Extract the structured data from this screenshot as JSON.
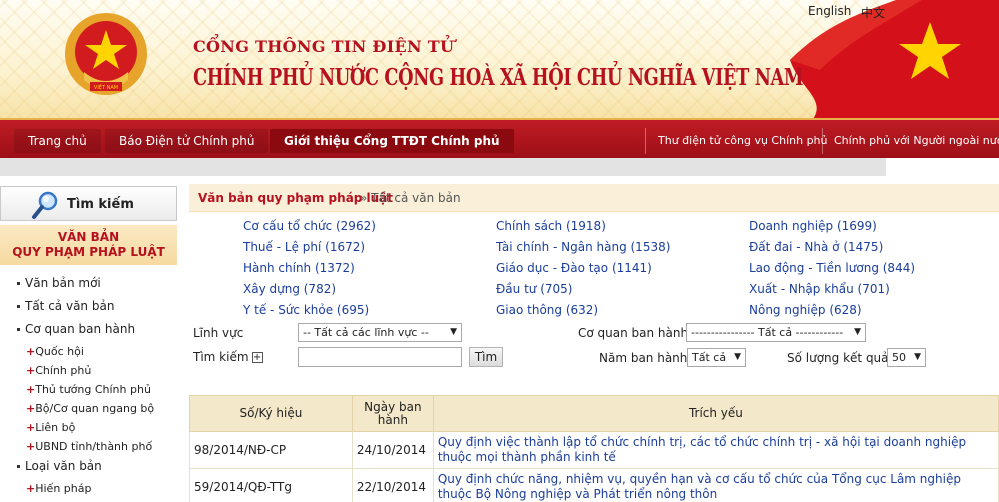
{
  "header": {
    "portal_title": "CỔNG THÔNG TIN ĐIỆN TỬ",
    "gov_title": "CHÍNH PHỦ NƯỚC CỘNG HOÀ XÃ HỘI CHỦ NGHĨA VIỆT NAM",
    "lang_en": "English",
    "lang_zh": "中文",
    "emblem_text": "VIỆT NAM"
  },
  "nav": {
    "tabs": [
      {
        "label": "Trang chủ"
      },
      {
        "label": "Báo Điện tử Chính phủ"
      },
      {
        "label": "Giới thiệu Cổng TTĐT Chính phủ"
      }
    ],
    "right_links": [
      {
        "label": "Thư điện tử công vụ Chính phủ"
      },
      {
        "label": "Chính phủ với Người ngoài nước"
      }
    ]
  },
  "sidebar": {
    "search_label": "Tìm kiếm",
    "section_title_1": "VĂN BẢN",
    "section_title_2": "QUY PHẠM PHÁP LUẬT",
    "items": [
      {
        "label": "Văn bản mới"
      },
      {
        "label": "Tất cả văn bản"
      },
      {
        "label": "Cơ quan ban hành"
      }
    ],
    "sub_items": [
      {
        "label": "Quốc hội"
      },
      {
        "label": "Chính phủ"
      },
      {
        "label": "Thủ tướng Chính phủ"
      },
      {
        "label": "Bộ/Cơ quan ngang bộ"
      },
      {
        "label": "Liên bộ"
      },
      {
        "label": "UBND tỉnh/thành phố"
      }
    ],
    "item_loai": "Loại văn bản",
    "sub_hien_phap": "Hiến pháp"
  },
  "breadcrumb": {
    "main": "Văn bản quy phạm pháp luật",
    "current": "» Tất cả văn bản"
  },
  "categories": [
    [
      "Cơ cấu tổ chức (2962)",
      "Chính sách (1918)",
      "Doanh nghiệp (1699)"
    ],
    [
      "Thuế - Lệ phí (1672)",
      "Tài chính - Ngân hàng (1538)",
      "Đất đai - Nhà ở (1475)"
    ],
    [
      "Hành chính (1372)",
      "Giáo dục - Đào tạo (1141)",
      "Lao động - Tiền lương (844)"
    ],
    [
      "Xây dựng (782)",
      "Đầu tư (705)",
      "Xuất - Nhập khẩu (701)"
    ],
    [
      "Y tế - Sức khỏe (695)",
      "Giao thông (632)",
      "Nông nghiệp (628)"
    ]
  ],
  "filters": {
    "linh_vuc_label": "Lĩnh vực",
    "linh_vuc_value": "-- Tất cả các lĩnh vực --",
    "co_quan_label": "Cơ quan ban hành",
    "co_quan_value": "---------------- Tất cả ------------",
    "tim_kiem_label": "Tìm kiếm",
    "tim_kiem_value": "",
    "search_button": "Tìm",
    "nam_label": "Năm ban hành",
    "nam_value": "Tất cả",
    "so_luong_label": "Số lượng kết quả",
    "so_luong_value": "50"
  },
  "table": {
    "headers": [
      "Số/Ký hiệu",
      "Ngày ban hành",
      "Trích yếu"
    ],
    "rows": [
      {
        "number": "98/2014/NĐ-CP",
        "date": "24/10/2014",
        "summary": "Quy định việc thành lập tổ chức chính trị, các tổ chức chính trị - xã hội tại doanh nghiệp thuộc mọi thành phần kinh tế"
      },
      {
        "number": "59/2014/QĐ-TTg",
        "date": "22/10/2014",
        "summary": "Quy định chức năng, nhiệm vụ, quyền hạn và cơ cấu tổ chức của Tổng cục Lâm nghiệp thuộc Bộ Nông nghiệp và Phát triển nông thôn"
      }
    ]
  },
  "colors": {
    "brand_red": "#b5111e",
    "link_blue": "#1b3e9a",
    "nav_red": "#a8141c"
  }
}
